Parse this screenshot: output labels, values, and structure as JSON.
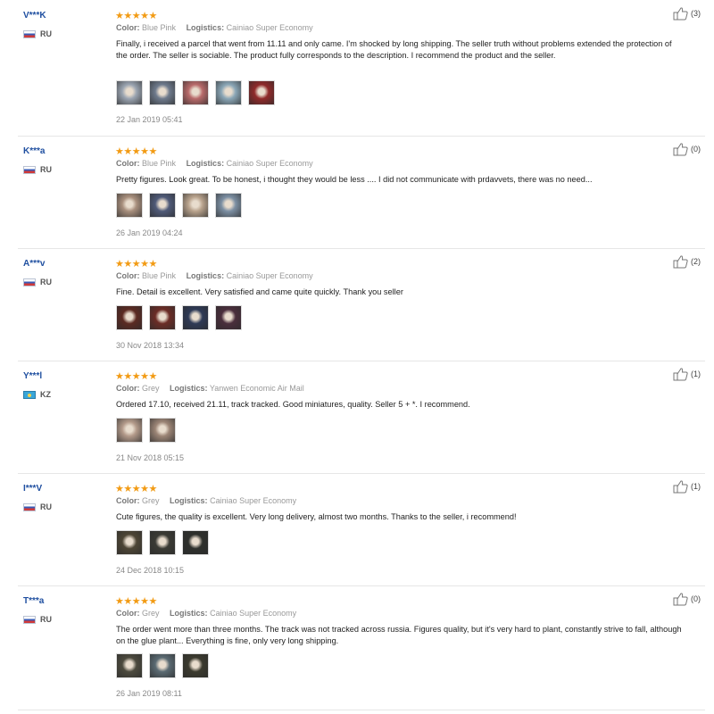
{
  "reviews": [
    {
      "user": "V***K",
      "country": "RU",
      "flag": "ru",
      "stars": "★★★★★",
      "color_label": "Color:",
      "color": "Blue Pink",
      "logistics_label": "Logistics:",
      "logistics": "Cainiao Super Economy",
      "text": "Finally, i received a parcel that went from 11.11 and only came. I'm shocked by long shipping. The seller truth without problems extended the protection of the order. The seller is sociable. The product fully corresponds to the description. I recommend the product and the seller.",
      "date": "22 Jan 2019 05:41",
      "likes": "(3)",
      "thumbs": [
        "#9aa4b1",
        "#6e7a8c",
        "#b86a6a",
        "#8aa6b6",
        "#8f2a2a"
      ]
    },
    {
      "user": "K***a",
      "country": "RU",
      "flag": "ru",
      "stars": "★★★★★",
      "color_label": "Color:",
      "color": "Blue Pink",
      "logistics_label": "Logistics:",
      "logistics": "Cainiao Super Economy",
      "text": "Pretty figures. Look great. To be honest, i thought they would be less .... I did not communicate with prdavvets, there was no need...",
      "date": "26 Jan 2019 04:24",
      "likes": "(0)",
      "thumbs": [
        "#a88f7d",
        "#4f5a78",
        "#b9a38d",
        "#7c8fa3"
      ]
    },
    {
      "user": "A***v",
      "country": "RU",
      "flag": "ru",
      "stars": "★★★★★",
      "color_label": "Color:",
      "color": "Blue Pink",
      "logistics_label": "Logistics:",
      "logistics": "Cainiao Super Economy",
      "text": "Fine. Detail is excellent. Very satisfied and came quite quickly. Thank you seller",
      "date": "30 Nov 2018 13:34",
      "likes": "(2)",
      "thumbs": [
        "#5b2a22",
        "#6b2c26",
        "#2e3a56",
        "#4a2e3c"
      ]
    },
    {
      "user": "Y***l",
      "country": "KZ",
      "flag": "kz",
      "stars": "★★★★★",
      "color_label": "Color:",
      "color": "Grey",
      "logistics_label": "Logistics:",
      "logistics": "Yanwen Economic Air Mail",
      "text": "Ordered 17.10, received 21.11, track tracked. Good miniatures, quality. Seller 5 + *. I recommend.",
      "date": "21 Nov 2018 05:15",
      "likes": "(1)",
      "thumbs": [
        "#b39a8a",
        "#9c8576"
      ]
    },
    {
      "user": "I***V",
      "country": "RU",
      "flag": "ru",
      "stars": "★★★★★",
      "color_label": "Color:",
      "color": "Grey",
      "logistics_label": "Logistics:",
      "logistics": "Cainiao Super Economy",
      "text": "Cute figures, the quality is excellent. Very long delivery, almost two months. Thanks to the seller, i recommend!",
      "date": "24 Dec 2018 10:15",
      "likes": "(1)",
      "thumbs": [
        "#4d4535",
        "#3a3a34",
        "#2e302c"
      ]
    },
    {
      "user": "T***a",
      "country": "RU",
      "flag": "ru",
      "stars": "★★★★★",
      "color_label": "Color:",
      "color": "Grey",
      "logistics_label": "Logistics:",
      "logistics": "Cainiao Super Economy",
      "text": "The order went more than three months. The track was not tracked across russia. Figures quality, but it's very hard to plant, constantly strive to fall, although on the glue plant... Everything is fine, only very long shipping.",
      "date": "26 Jan 2019 08:11",
      "likes": "(0)",
      "thumbs": [
        "#4c4a3e",
        "#5a6a72",
        "#3b3a2e"
      ]
    }
  ]
}
